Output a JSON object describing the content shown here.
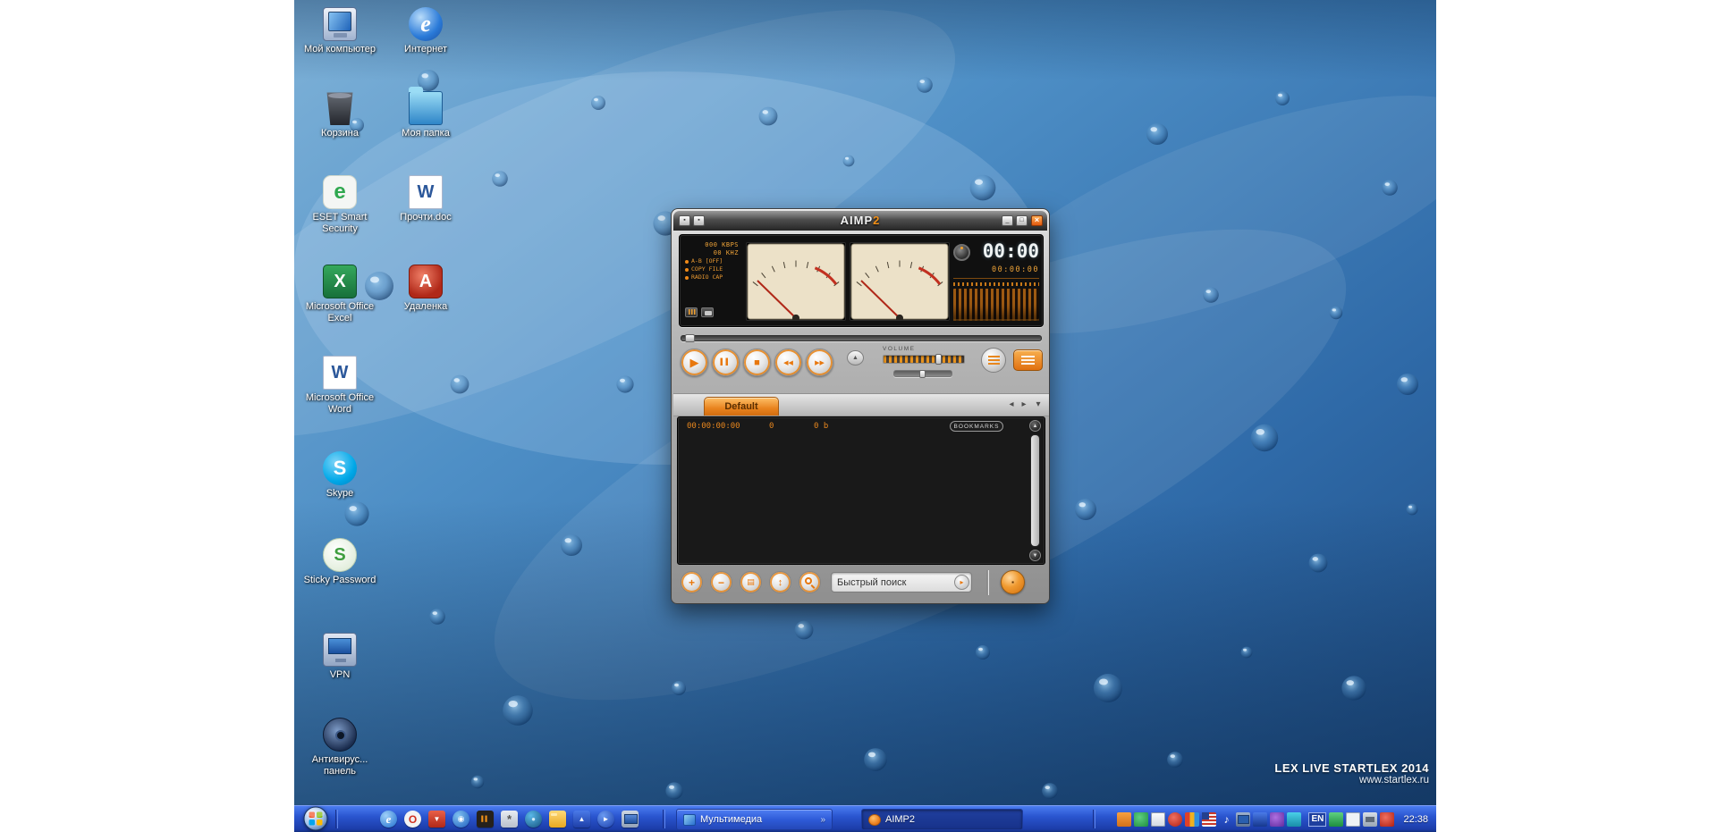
{
  "desktop": {
    "icons": [
      {
        "name": "my-computer",
        "label": "Мой компьютер",
        "glyph": ""
      },
      {
        "name": "internet",
        "label": "Интернет",
        "glyph": "e"
      },
      {
        "name": "recycle-bin",
        "label": "Корзина",
        "glyph": ""
      },
      {
        "name": "my-folder",
        "label": "Моя папка",
        "glyph": ""
      },
      {
        "name": "eset-smart-security",
        "label": "ESET Smart Security",
        "glyph": "e"
      },
      {
        "name": "readme-doc",
        "label": "Прочти.doc",
        "glyph": "W"
      },
      {
        "name": "ms-office-excel",
        "label": "Microsoft Office Excel",
        "glyph": "X"
      },
      {
        "name": "udalenka",
        "label": "Удаленка",
        "glyph": "A"
      },
      {
        "name": "ms-office-word",
        "label": "Microsoft Office Word",
        "glyph": "W"
      },
      {
        "name": "skype",
        "label": "Skype",
        "glyph": "S"
      },
      {
        "name": "sticky-password",
        "label": "Sticky Password",
        "glyph": "S"
      },
      {
        "name": "vpn",
        "label": "VPN",
        "glyph": ""
      },
      {
        "name": "antivirus-panel",
        "label": "Антивирус... панель",
        "glyph": ""
      }
    ],
    "credit": {
      "line1": "LEX LIVE STARTLEX 2014",
      "line2": "www.startlex.ru"
    }
  },
  "player": {
    "window": {
      "title_main": "AIMP",
      "title_accent": "2",
      "left_button_1_glyph": "▪",
      "left_button_2_glyph": "▪",
      "minimize_glyph": "_",
      "maximize_glyph": "□",
      "close_glyph": "×"
    },
    "display": {
      "bitrate": "000 KBPS",
      "samplerate": "00 KHZ",
      "flags": [
        "A-B [OFF]",
        "COPY FILE",
        "RADIO CAP"
      ],
      "time_main": "00:00",
      "time_detail": "00:00:00"
    },
    "controls": {
      "play_glyph": "▶",
      "pause_glyph": "▌▌",
      "stop_glyph": "■",
      "prev_glyph": "◀◀",
      "next_glyph": "▶▶",
      "eject_glyph": "▲",
      "volume_label": "VOLUME"
    },
    "playlist": {
      "tab_label": "Default",
      "tab_prev_glyph": "◂",
      "tab_next_glyph": "▸",
      "tab_menu_glyph": "▾",
      "total_time": "00:00:00:00",
      "track_count": "0",
      "total_size": "0 b",
      "bookmarks_label": "BOOKMARKS",
      "scroll_up_glyph": "▲",
      "scroll_down_glyph": "▼",
      "add_glyph": "+",
      "remove_glyph": "−",
      "select_glyph": "▤",
      "sort_glyph": "↕",
      "search_text": "Быстрый поиск",
      "search_go_glyph": "▸",
      "mode_glyph": "▪"
    }
  },
  "taskbar": {
    "quicklaunch": [
      {
        "name": "internet-explorer",
        "glyph": "e"
      },
      {
        "name": "opera",
        "glyph": "O"
      },
      {
        "name": "download-master",
        "glyph": "▼"
      },
      {
        "name": "messenger",
        "glyph": "◉"
      },
      {
        "name": "aimp-mini",
        "glyph": "▌▌"
      },
      {
        "name": "settings",
        "glyph": "*"
      },
      {
        "name": "network",
        "glyph": "●"
      },
      {
        "name": "folder",
        "glyph": ""
      },
      {
        "name": "update",
        "glyph": "▲"
      },
      {
        "name": "media-player",
        "glyph": "►"
      },
      {
        "name": "show-desktop",
        "glyph": ""
      }
    ],
    "tasks": [
      {
        "label": "Мультимедиа",
        "overflow_glyph": "»"
      },
      {
        "label": "AIMP2"
      }
    ],
    "tray": {
      "icon_names": [
        "app-orange",
        "antivirus-green",
        "document-white",
        "alert-red",
        "palette",
        "us-flag",
        "volume-speaker",
        "network-monitors",
        "shield-blue",
        "app-purple",
        "app-teal"
      ],
      "icon_names_right": [
        "app-green",
        "cursor",
        "printer",
        "alert-red"
      ],
      "volume_glyph": "♪",
      "language": "EN",
      "clock": "22:38"
    }
  }
}
